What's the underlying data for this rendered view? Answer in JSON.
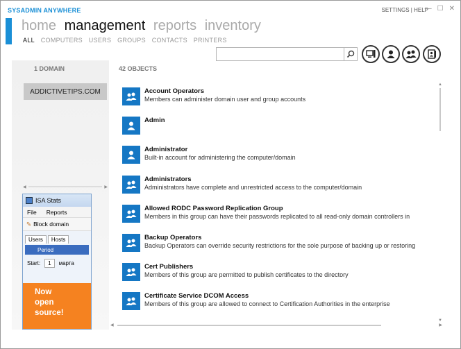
{
  "app": {
    "title": "SYSADMIN ANYWHERE"
  },
  "top_links": {
    "settings": "SETTINGS",
    "sep": "|",
    "help": "HELP"
  },
  "window_controls": {
    "minimize": "—",
    "maximize": "☐",
    "close": "✕"
  },
  "main_nav": [
    {
      "label": "home",
      "active": false
    },
    {
      "label": "management",
      "active": true
    },
    {
      "label": "reports",
      "active": false
    },
    {
      "label": "inventory",
      "active": false
    }
  ],
  "sub_nav": [
    {
      "label": "ALL",
      "active": true
    },
    {
      "label": "COMPUTERS",
      "active": false
    },
    {
      "label": "USERS",
      "active": false
    },
    {
      "label": "GROUPS",
      "active": false
    },
    {
      "label": "CONTACTS",
      "active": false
    },
    {
      "label": "PRINTERS",
      "active": false
    }
  ],
  "search": {
    "value": "",
    "placeholder": ""
  },
  "left_pane": {
    "count_label": "1 DOMAIN",
    "domain": "ADDICTIVETIPS.COM"
  },
  "objects": {
    "count_label": "42 OBJECTS",
    "items": [
      {
        "name": "Account Operators",
        "desc": "Members can administer domain user and group accounts",
        "kind": "group"
      },
      {
        "name": "Admin",
        "desc": "",
        "kind": "user"
      },
      {
        "name": "Administrator",
        "desc": "Built-in account for administering the computer/domain",
        "kind": "user"
      },
      {
        "name": "Administrators",
        "desc": "Administrators have complete and unrestricted access to the computer/domain",
        "kind": "group"
      },
      {
        "name": "Allowed RODC Password Replication Group",
        "desc": "Members in this group can have their passwords replicated to all read-only domain controllers in",
        "kind": "group"
      },
      {
        "name": "Backup Operators",
        "desc": "Backup Operators can override security restrictions for the sole purpose of backing up or restoring",
        "kind": "group"
      },
      {
        "name": "Cert Publishers",
        "desc": "Members of this group are permitted to publish certificates to the directory",
        "kind": "group"
      },
      {
        "name": "Certificate Service DCOM Access",
        "desc": "Members of this group are allowed to connect to Certification Authorities in the enterprise",
        "kind": "group"
      }
    ]
  },
  "ad": {
    "title": "ISA Stats",
    "menu": [
      "File",
      "Reports"
    ],
    "toolbar": "Block domain",
    "tabs": [
      "Users",
      "Hosts"
    ],
    "period": "Period",
    "start_label": "Start:",
    "start_value": "1",
    "start_month": "марта",
    "promo": [
      "Now",
      "open",
      "source!"
    ]
  },
  "colors": {
    "accent": "#1a8fd6",
    "icon_bg": "#1577c4",
    "promo": "#f58220"
  }
}
